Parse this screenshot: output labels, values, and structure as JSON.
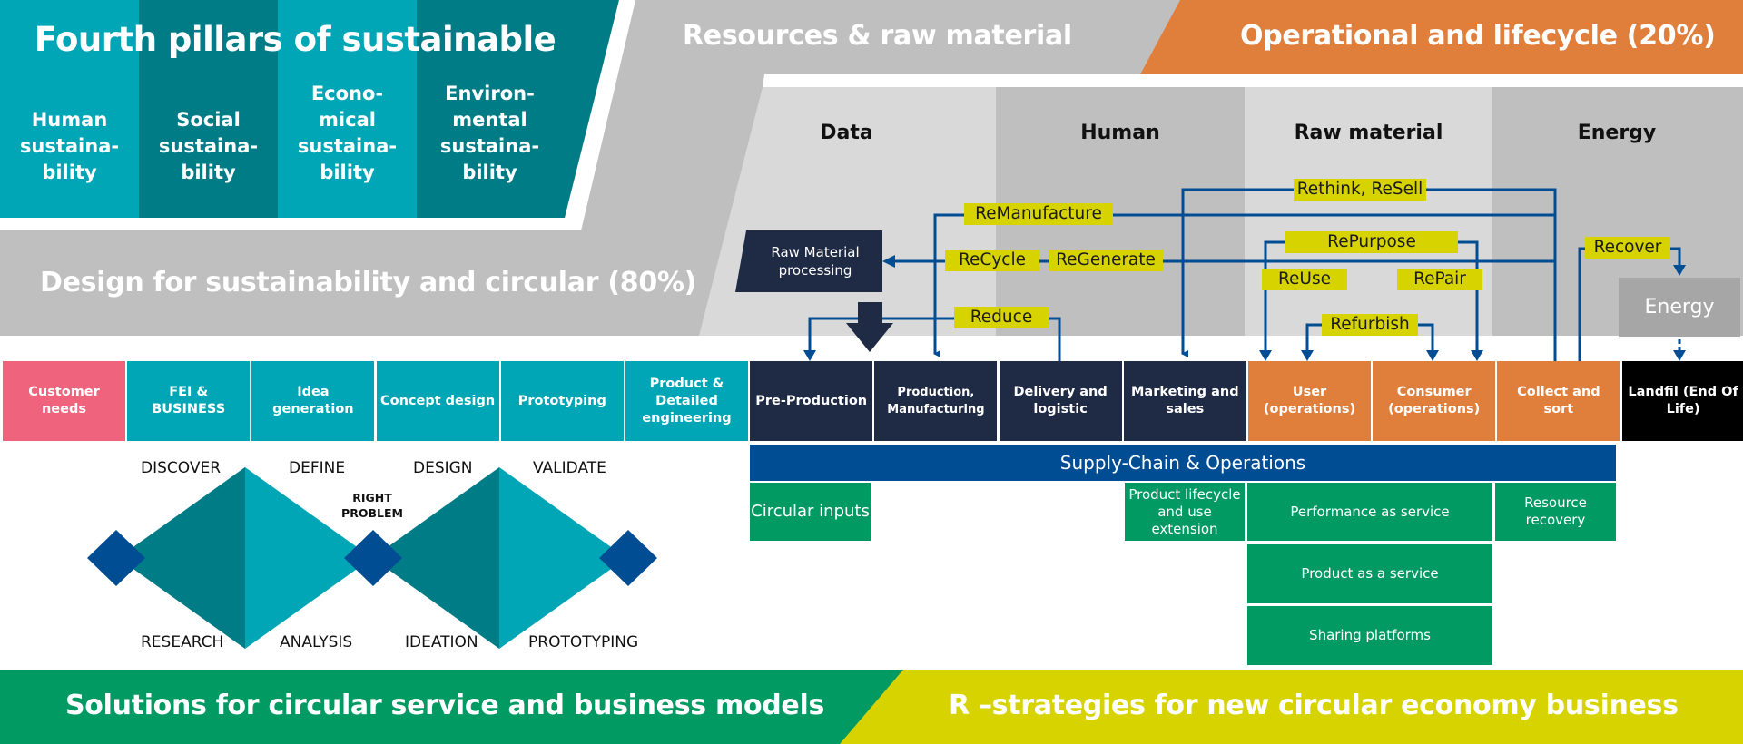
{
  "colors": {
    "teal": "#00a6b5",
    "teal_dark": "#007c87",
    "gray": "#bfbfbf",
    "gray_light": "#d9d9d9",
    "orange": "#e07e3c",
    "navy": "#1f2a44",
    "pink": "#f0637c",
    "blue": "#014d94",
    "green": "#009a62",
    "yellow": "#d7d300",
    "black": "#000000"
  },
  "pillars": {
    "title": "Fourth pillars of sustainable",
    "items": [
      {
        "label": "Human sustaina-bility",
        "lines": [
          "Human",
          "sustaina-",
          "bility"
        ]
      },
      {
        "label": "Social sustaina-bility",
        "lines": [
          "Social",
          "sustaina-",
          "bility"
        ]
      },
      {
        "label": "Econo-mical sustaina-bility",
        "lines": [
          "Econo-",
          "mical",
          "sustaina-",
          "bility"
        ]
      },
      {
        "label": "Environ-mental sustaina-bility",
        "lines": [
          "Environ-",
          "mental",
          "sustaina-",
          "bility"
        ]
      }
    ]
  },
  "bands": {
    "design": "Design for sustainability and circular (80%)",
    "resources": "Resources & raw material",
    "operational": "Operational and lifecycle (20%)",
    "solutions": "Solutions for circular service and business models",
    "rstrategies": "R –strategies for new circular economy business"
  },
  "resource_columns": [
    "Data",
    "Human",
    "Raw material",
    "Energy"
  ],
  "raw_material_box": "Raw Material processing",
  "energy_box": "Energy",
  "process_steps": [
    {
      "label": "Customer needs",
      "color": "pink"
    },
    {
      "label": "FEI & BUSINESS",
      "color": "teal"
    },
    {
      "label": "Idea generation",
      "color": "teal"
    },
    {
      "label": "Concept design",
      "color": "teal"
    },
    {
      "label": "Prototyping",
      "color": "teal"
    },
    {
      "label": "Product & Detailed engineering",
      "color": "teal"
    },
    {
      "label": "Pre-Production",
      "color": "navy"
    },
    {
      "label": "Production, Manufacturing",
      "color": "navy"
    },
    {
      "label": "Delivery and logistic",
      "color": "navy"
    },
    {
      "label": "Marketing and sales",
      "color": "navy"
    },
    {
      "label": "User (operations)",
      "color": "orange"
    },
    {
      "label": "Consumer (operations)",
      "color": "orange"
    },
    {
      "label": "Collect and sort",
      "color": "orange"
    },
    {
      "label": "Landfil (End Of Life)",
      "color": "black"
    }
  ],
  "r_strategies": [
    "Rethink, ReSell",
    "ReManufacture",
    "RePurpose",
    "Recover",
    "ReCycle",
    "ReGenerate",
    "ReUse",
    "RePair",
    "Reduce",
    "Refurbish"
  ],
  "supply_chain": "Supply-Chain & Operations",
  "business_models": [
    "Circular inputs",
    "Product lifecycle and use extension",
    "Performance as service",
    "Resource recovery",
    "Product as a service",
    "Sharing platforms"
  ],
  "double_diamond": {
    "top_labels": [
      "DISCOVER",
      "DEFINE",
      "DESIGN",
      "VALIDATE"
    ],
    "bottom_labels": [
      "RESEARCH",
      "ANALYSIS",
      "IDEATION",
      "PROTOTYPING"
    ],
    "center_label": "RIGHT PROBLEM"
  }
}
